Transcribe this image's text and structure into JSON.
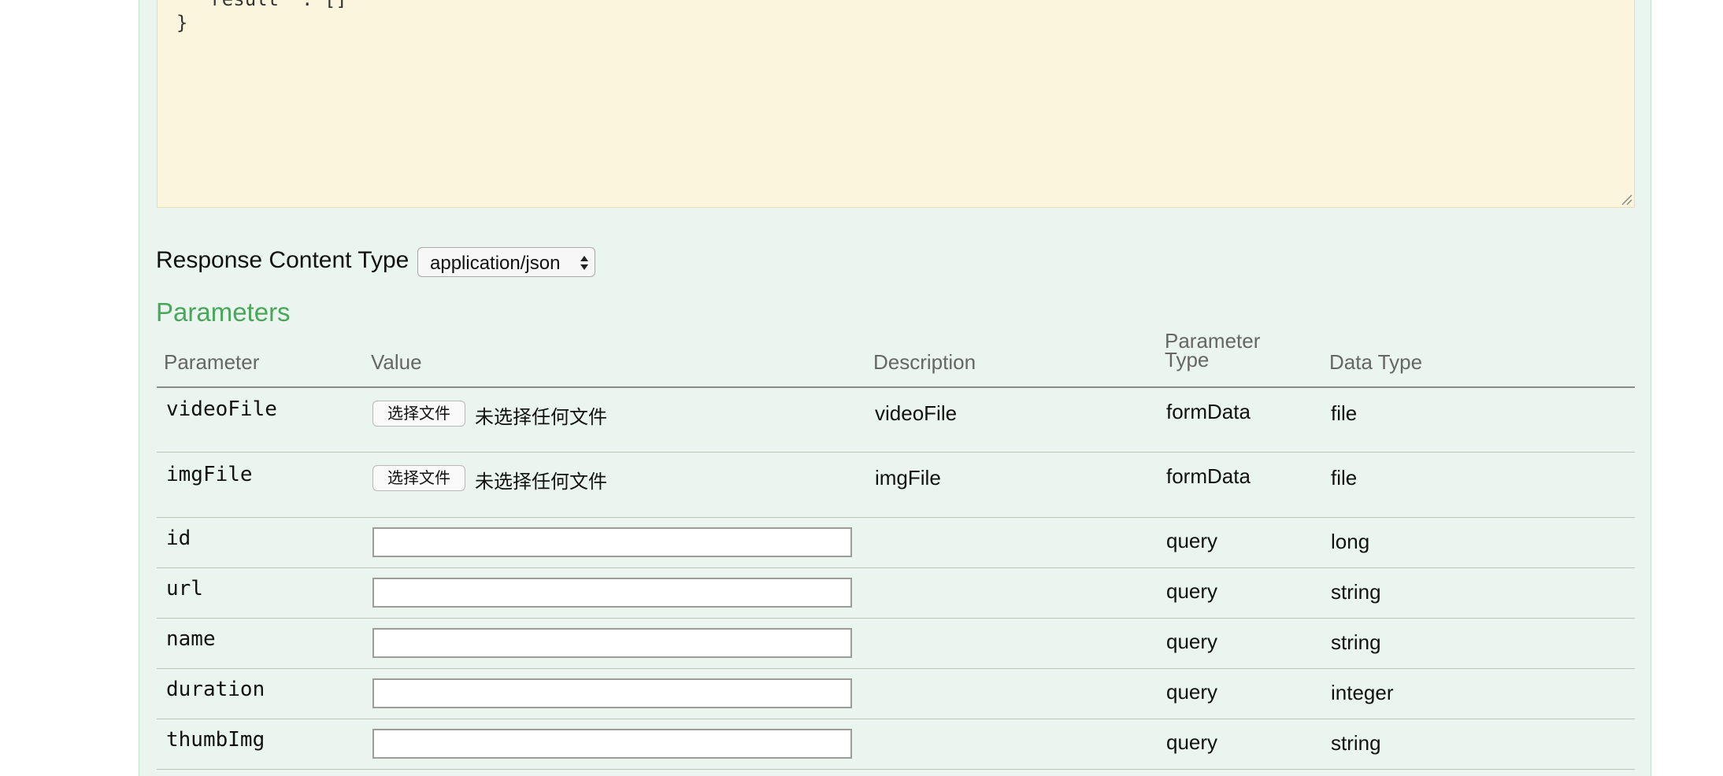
{
  "code_box": {
    "lines": [
      "  \"result\" : []",
      "}"
    ]
  },
  "response_content_type": {
    "label": "Response Content Type",
    "selected": "application/json"
  },
  "parameters": {
    "title": "Parameters",
    "headers": {
      "parameter": "Parameter",
      "value": "Value",
      "description": "Description",
      "parameter_type_line1": "Parameter",
      "parameter_type_line2": "Type",
      "data_type": "Data Type"
    },
    "file_rows": [
      {
        "name": "videoFile",
        "button": "选择文件",
        "status": "未选择任何文件",
        "description": "videoFile",
        "param_type": "formData",
        "data_type": "file"
      },
      {
        "name": "imgFile",
        "button": "选择文件",
        "status": "未选择任何文件",
        "description": "imgFile",
        "param_type": "formData",
        "data_type": "file"
      }
    ],
    "query_rows": [
      {
        "name": "id",
        "value": "",
        "param_type": "query",
        "data_type": "long"
      },
      {
        "name": "url",
        "value": "",
        "param_type": "query",
        "data_type": "string"
      },
      {
        "name": "name",
        "value": "",
        "param_type": "query",
        "data_type": "string"
      },
      {
        "name": "duration",
        "value": "",
        "param_type": "query",
        "data_type": "integer"
      },
      {
        "name": "thumbImg",
        "value": "",
        "param_type": "query",
        "data_type": "string"
      }
    ]
  }
}
